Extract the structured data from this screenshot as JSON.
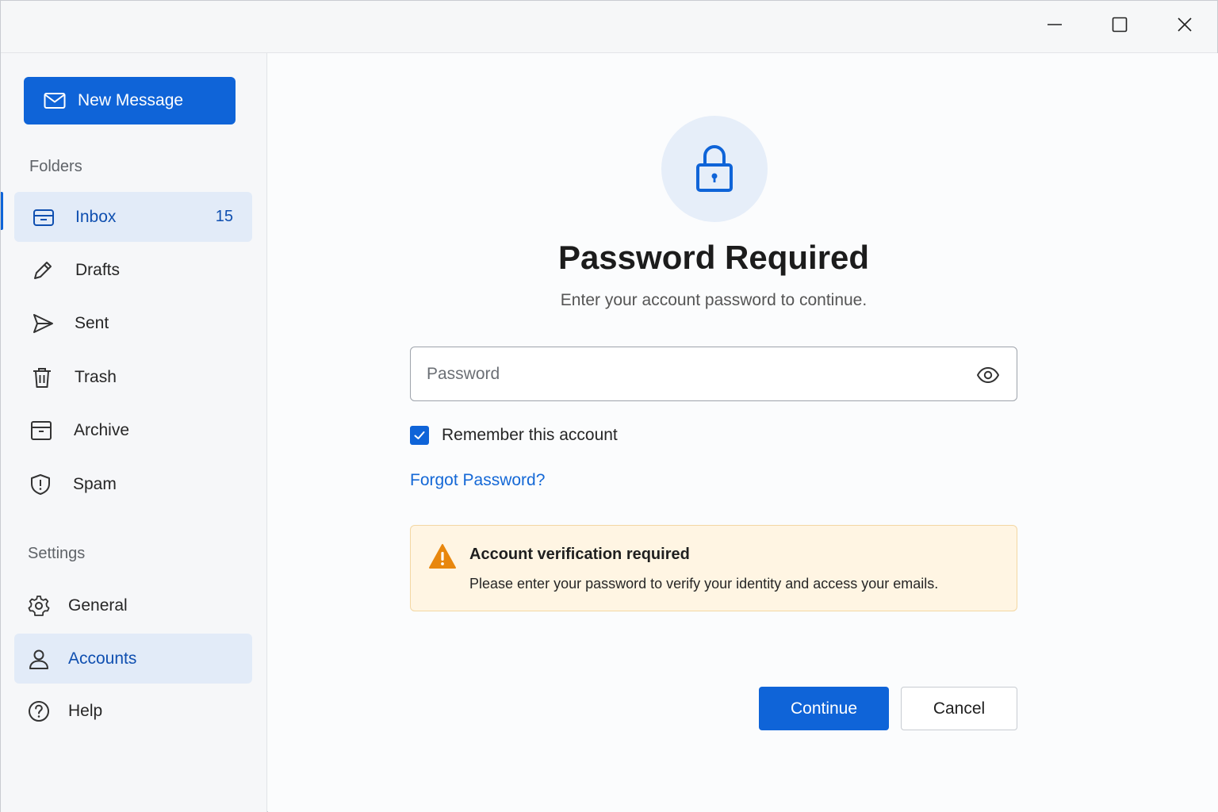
{
  "window": {
    "controls": {
      "minimize_icon": "minimize-icon",
      "maximize_icon": "maximize-icon",
      "close_icon": "close-icon"
    }
  },
  "sidebar": {
    "new_message_label": "New Message",
    "folders_label": "Folders",
    "folders": [
      {
        "label": "Inbox",
        "icon": "inbox-icon",
        "count": "15",
        "active": true
      },
      {
        "label": "Drafts",
        "icon": "pencil-icon"
      },
      {
        "label": "Sent",
        "icon": "send-icon"
      },
      {
        "label": "Trash",
        "icon": "trash-icon"
      },
      {
        "label": "Archive",
        "icon": "archive-icon"
      },
      {
        "label": "Spam",
        "icon": "shield-icon"
      }
    ],
    "settings_label": "Settings",
    "settings": [
      {
        "label": "General",
        "icon": "gear-icon"
      },
      {
        "label": "Accounts",
        "icon": "user-icon",
        "active": true
      },
      {
        "label": "Help",
        "icon": "help-icon"
      }
    ]
  },
  "dialog": {
    "icon": "lock-icon",
    "title": "Password Required",
    "subtitle": "Enter your account password to continue.",
    "password_placeholder": "Password",
    "password_value": "",
    "remember_label": "Remember this account",
    "remember_checked": true,
    "forgot_link": "Forgot Password?",
    "alert": {
      "icon": "warning-icon",
      "title": "Account verification required",
      "text": "Please enter your password to verify your identity and access your emails."
    },
    "continue_label": "Continue",
    "cancel_label": "Cancel"
  },
  "colors": {
    "accent": "#0f64d8",
    "active_bg": "#e2ebf8",
    "alert_bg": "#fff5e3",
    "alert_border": "#f3d7a3",
    "warning": "#e8870e"
  }
}
